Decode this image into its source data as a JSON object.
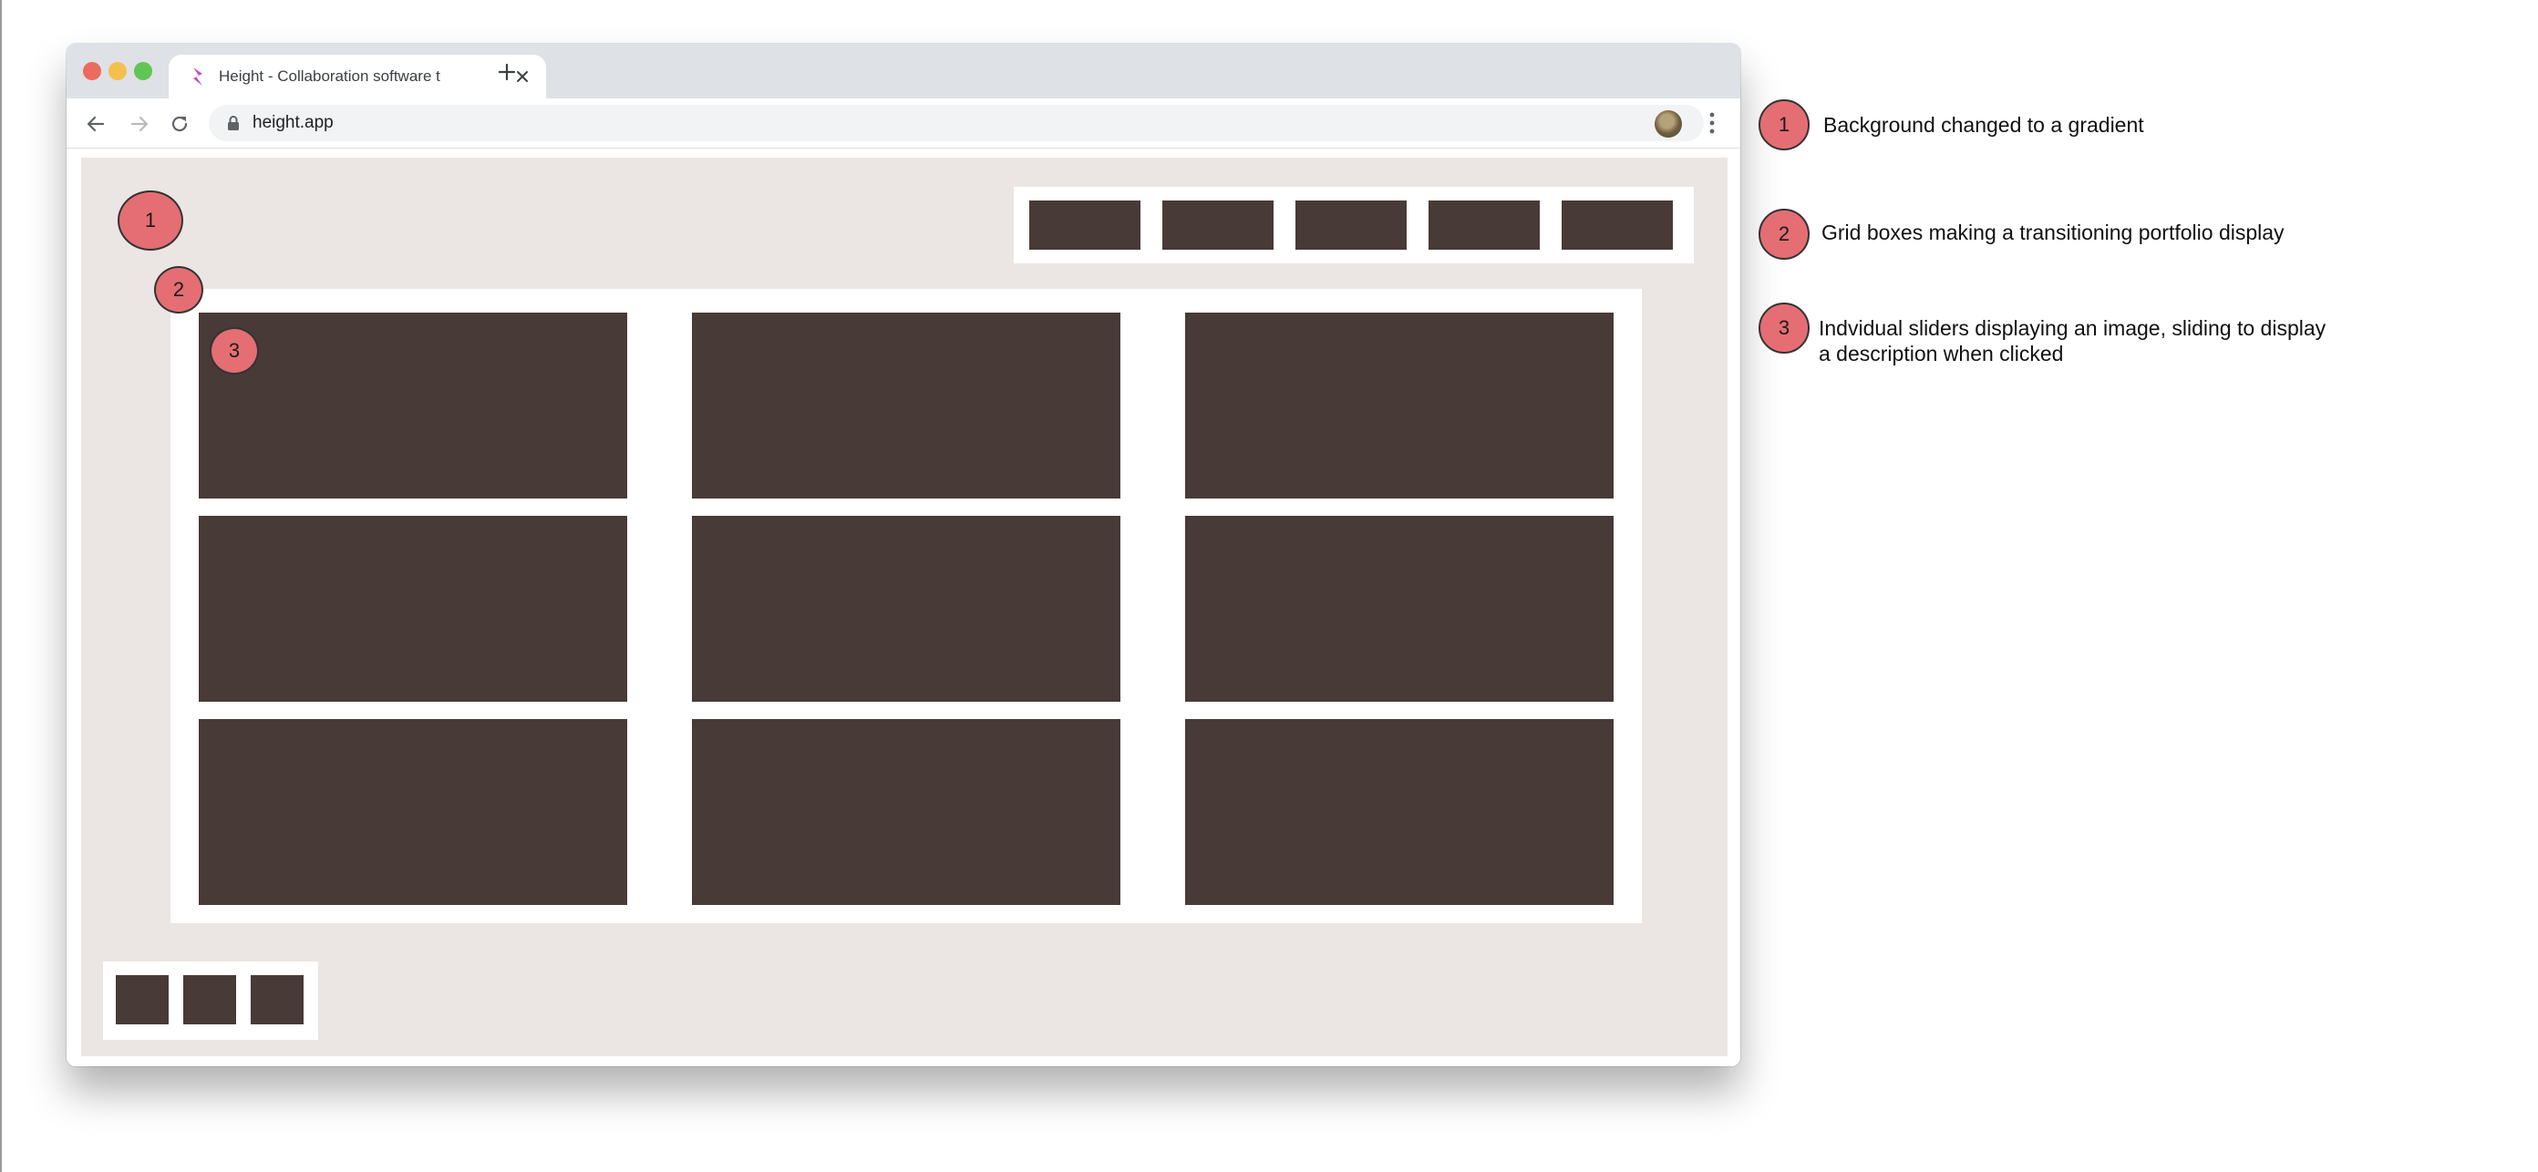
{
  "browser": {
    "tab_title": "Height - Collaboration software t",
    "url": "height.app"
  },
  "markers": {
    "background": "1",
    "grid": "2",
    "slider": "3"
  },
  "legend": [
    {
      "number": "1",
      "text": "Background changed to a gradient"
    },
    {
      "number": "2",
      "text": "Grid boxes making a transitioning portfolio display"
    },
    {
      "number": "3",
      "line1": "Indvidual sliders displaying an image, sliding to display",
      "line2": "a description when clicked"
    }
  ],
  "colors": {
    "canvas": "#ebe6e3",
    "box": "#483a37",
    "marker": "#e46e73"
  }
}
